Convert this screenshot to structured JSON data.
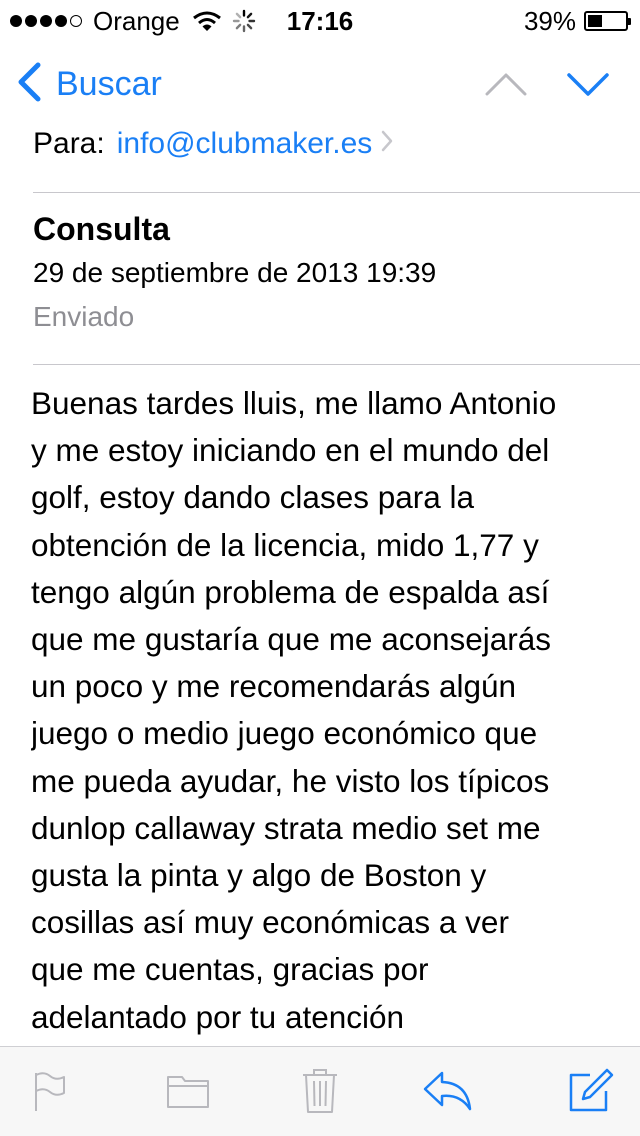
{
  "status_bar": {
    "carrier": "Orange",
    "time": "17:16",
    "battery_percent": "39%",
    "battery_level": 0.39,
    "signal_bars_filled": 4,
    "signal_bars_total": 5
  },
  "nav": {
    "back_label": "Buscar",
    "back_icon": "chevron-left-icon",
    "prev_icon": "chevron-up-icon",
    "next_icon": "chevron-down-icon"
  },
  "header": {
    "to_label": "Para:",
    "to_address": "info@clubmaker.es",
    "subject": "Consulta",
    "date": "29 de septiembre de 2013 19:39",
    "mailbox": "Enviado"
  },
  "body": {
    "lines": [
      "Buenas tardes lluis, me llamo Antonio",
      "y me estoy iniciando en el mundo del",
      "golf, estoy dando clases para la",
      "obtención de la licencia, mido 1,77 y",
      "tengo algún problema de espalda así",
      "que me gustaría que me aconsejarás",
      "un poco y me recomendarás algún",
      "juego o medio juego económico que",
      "me pueda ayudar, he visto los típicos",
      "dunlop callaway strata medio set me",
      "gusta la pinta y algo de Boston y",
      "cosillas así muy económicas a ver",
      "que me cuentas, gracias por",
      "adelantado por tu atención"
    ]
  },
  "toolbar": {
    "items": [
      "flag-icon",
      "folder-icon",
      "trash-icon",
      "reply-icon",
      "compose-icon"
    ]
  },
  "colors": {
    "accent": "#1a7ff5",
    "disabled": "#b8b8bd",
    "secondary_text": "#8e8e93",
    "separator": "#c8c7cc",
    "toolbar_bg": "#f7f7f7"
  }
}
